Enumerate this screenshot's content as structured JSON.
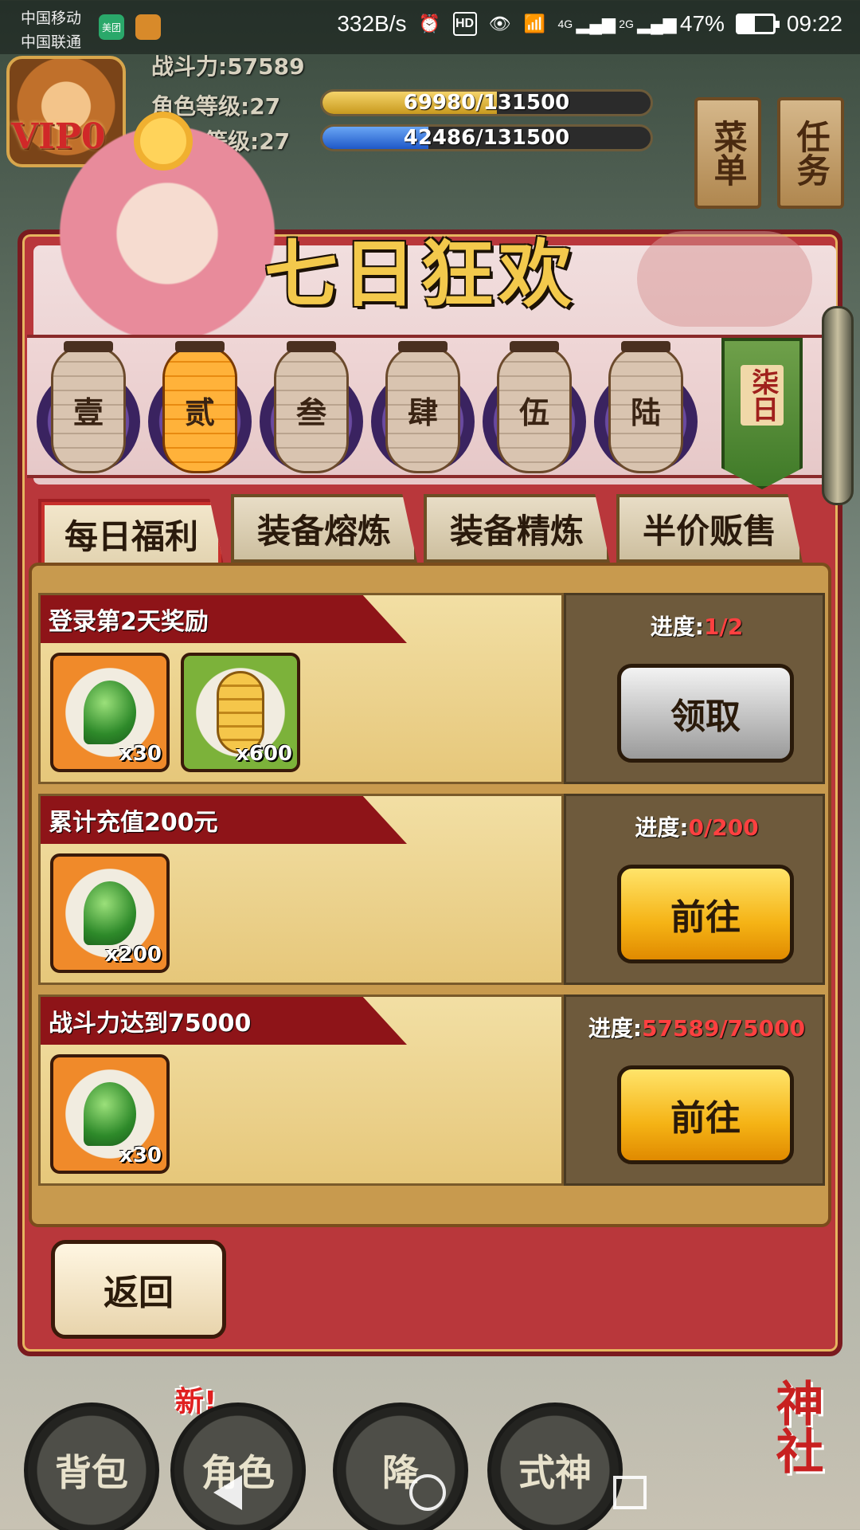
{
  "status_bar": {
    "carrier1": "中国移动",
    "carrier2": "中国联通",
    "app_badge": "美团",
    "net_speed": "332B/s",
    "hd": "HD",
    "net4g": "4G",
    "net2g": "2G",
    "battery": "47%",
    "battery_level": 0.47,
    "time": "09:22"
  },
  "player": {
    "vip": "VIP0",
    "power": "战斗力:57589",
    "role_level_label": "角色等级:27",
    "role_exp": "69980/131500",
    "role_exp_ratio": 0.532,
    "second_level_label": "等级:27",
    "second_exp": "42486/131500",
    "second_exp_ratio": 0.323
  },
  "side_buttons": {
    "menu": "菜单",
    "task": "任务"
  },
  "dialog": {
    "title": "七日狂欢",
    "days": [
      "壹",
      "贰",
      "叁",
      "肆",
      "伍",
      "陆"
    ],
    "active_day": 1,
    "day7": "柒日",
    "tabs": [
      "每日福利",
      "装备熔炼",
      "装备精炼",
      "半价贩售"
    ],
    "active_tab": 0,
    "tasks": [
      {
        "title": "登录第2天奖励",
        "progress_label": "进度:",
        "progress_value": "1/2",
        "button": "领取",
        "button_style": "grey",
        "items": [
          {
            "type": "gem-icon",
            "qty": "x30",
            "frame": "orange"
          },
          {
            "type": "coin-icon",
            "qty": "x600",
            "frame": "green"
          }
        ]
      },
      {
        "title": "累计充值200元",
        "progress_label": "进度:",
        "progress_value": "0/200",
        "button": "前往",
        "button_style": "gold",
        "items": [
          {
            "type": "gem-icon",
            "qty": "x200",
            "frame": "orange"
          }
        ]
      },
      {
        "title": "战斗力达到75000",
        "progress_label": "进度:",
        "progress_value": "57589/75000",
        "button": "前往",
        "button_style": "gold",
        "items": [
          {
            "type": "gem-icon",
            "qty": "x30",
            "frame": "orange"
          }
        ]
      }
    ],
    "return_button": "返回"
  },
  "bottom_menu": {
    "new_badge": "新!",
    "buttons": [
      "背包",
      "角色",
      "降",
      "式神"
    ],
    "shrine": "神社"
  },
  "colors": {
    "dialog_red": "#b9373b",
    "title_gold": "#f3c94c",
    "progress_red": "#ff4040",
    "button_gold": "#f5b315"
  }
}
